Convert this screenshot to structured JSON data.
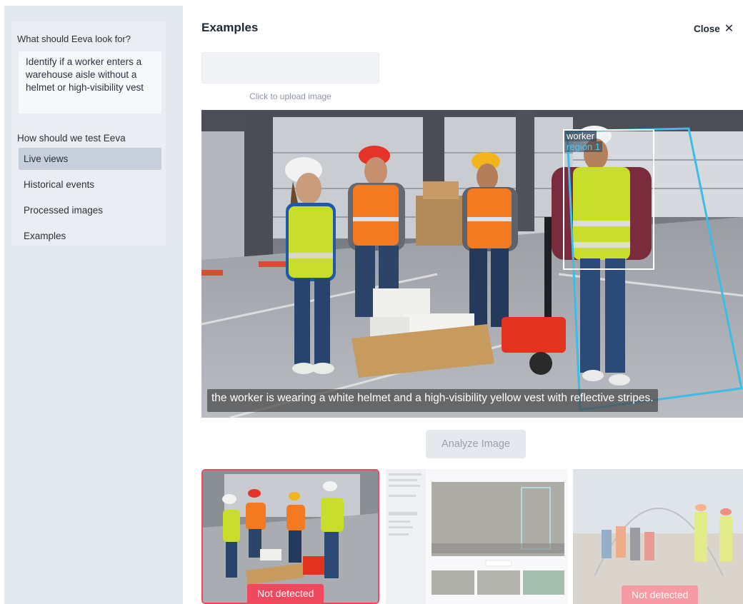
{
  "sidebar": {
    "question_label": "What should Eeva look for?",
    "prompt_text": "Identify if a worker enters a warehouse aisle without a helmet or high-visibility vest",
    "test_label": "How should we test Eeva",
    "nav": [
      {
        "label": "Live views",
        "active": true
      },
      {
        "label": "Historical events",
        "active": false
      },
      {
        "label": "Processed images",
        "active": false
      },
      {
        "label": "Examples",
        "active": false
      }
    ]
  },
  "header": {
    "title": "Examples",
    "close_label": "Close",
    "close_icon": "close-icon"
  },
  "upload": {
    "caption": "Click to upload image"
  },
  "preview": {
    "detection_label": "worker",
    "region_label": "region 1",
    "caption": "the worker is wearing a white helmet and a high-visibility yellow vest with reflective stripes."
  },
  "analyze_button": "Analyze Image",
  "thumbnails": [
    {
      "badge": "Not detected",
      "selected": true
    },
    {
      "badge": "",
      "selected": false
    },
    {
      "badge": "Not detected",
      "selected": false
    }
  ],
  "colors": {
    "accent_red": "#f0485d",
    "region_blue": "#3bbde8",
    "sidebar_bg": "#e4e8ef"
  }
}
